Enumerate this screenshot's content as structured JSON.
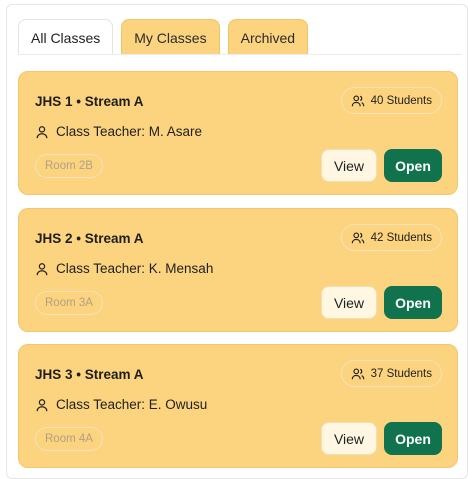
{
  "tabs": [
    {
      "label": "All Classes",
      "active": false
    },
    {
      "label": "My Classes",
      "active": true
    },
    {
      "label": "Archived",
      "active": false
    }
  ],
  "classes": [
    {
      "title": "JHS 1 • Stream A",
      "students": "40 Students",
      "teacher": "Class Teacher: M. Asare",
      "room": "Room 2B",
      "view_label": "View",
      "open_label": "Open"
    },
    {
      "title": "JHS 2 • Stream A",
      "students": "42 Students",
      "teacher": "Class Teacher: K. Mensah",
      "room": "Room 3A",
      "view_label": "View",
      "open_label": "Open"
    },
    {
      "title": "JHS 3 • Stream A",
      "students": "37 Students",
      "teacher": "Class Teacher: E. Owusu",
      "room": "Room 4A",
      "view_label": "View",
      "open_label": "Open"
    }
  ],
  "colors": {
    "card_bg": "#fcd37e",
    "open_button": "#10734e",
    "active_tab": "#fcd37e"
  },
  "icons": {
    "students": "users-icon",
    "teacher": "user-icon"
  }
}
